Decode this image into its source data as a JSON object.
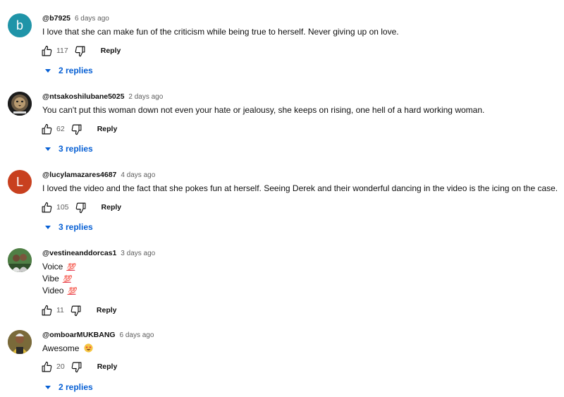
{
  "comments": [
    {
      "author": "@b7925",
      "time": "6 days ago",
      "avatar_letter": "b",
      "avatar_color": "#1f94a8",
      "lines": [
        "I love that she can make fun of the criticism while being true to herself. Never giving up on love."
      ],
      "likes": "117",
      "reply_label": "Reply",
      "replies_label": "2 replies"
    },
    {
      "author": "@ntsakoshilubane5025",
      "time": "2 days ago",
      "avatar_icon": "lion-photo-avatar",
      "lines": [
        "You can't put this woman down not even your hate or jealousy, she keeps on rising, one hell of a hard working woman."
      ],
      "likes": "62",
      "reply_label": "Reply",
      "replies_label": "3 replies"
    },
    {
      "author": "@lucylamazares4687",
      "time": "4 days ago",
      "avatar_letter": "L",
      "avatar_color": "#c8401f",
      "lines": [
        "I loved the video and the fact that she pokes fun at herself. Seeing Derek and their wonderful dancing in the video is the icing on the case."
      ],
      "likes": "105",
      "reply_label": "Reply",
      "replies_label": "3 replies"
    },
    {
      "author": "@vestineanddorcas1",
      "time": "3 days ago",
      "avatar_icon": "people-photo-avatar",
      "lines": [
        "Voice",
        "Vibe",
        "Video"
      ],
      "line_emoji": "💯",
      "likes": "11",
      "reply_label": "Reply"
    },
    {
      "author": "@omboarMUKBANG",
      "time": "6 days ago",
      "avatar_icon": "person-photo-avatar",
      "lines": [
        "Awesome"
      ],
      "line_emoji": "🤩",
      "likes": "20",
      "reply_label": "Reply",
      "replies_label": "2 replies"
    }
  ],
  "colors": {
    "link_blue": "#065fd4",
    "meta_gray": "#606060",
    "text": "#0f0f0f"
  }
}
